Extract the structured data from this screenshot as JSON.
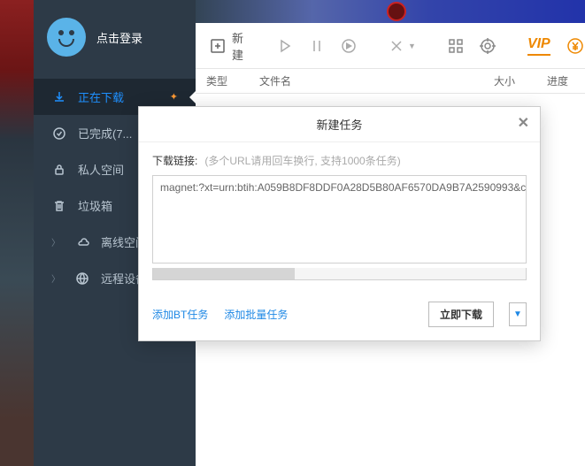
{
  "user": {
    "login_text": "点击登录"
  },
  "sidebar": {
    "items": [
      {
        "label": "正在下载"
      },
      {
        "label": "已完成(7..."
      },
      {
        "label": "私人空间"
      },
      {
        "label": "垃圾箱"
      },
      {
        "label": "离线空间"
      },
      {
        "label": "远程设备"
      }
    ]
  },
  "toolbar": {
    "new_label": "新建",
    "vip_label": "VIP"
  },
  "headers": {
    "type": "类型",
    "filename": "文件名",
    "size": "大小",
    "progress": "进度"
  },
  "dialog": {
    "title": "新建任务",
    "label": "下载链接:",
    "hint": "(多个URL请用回车换行, 支持1000条任务)",
    "textarea_value": "magnet:?xt=urn:btih:A059B8DF8DDF0A28D5B80AF6570DA9B7A2590993&c",
    "bt_link": "添加BT任务",
    "batch_link": "添加批量任务",
    "download_btn": "立即下载"
  }
}
